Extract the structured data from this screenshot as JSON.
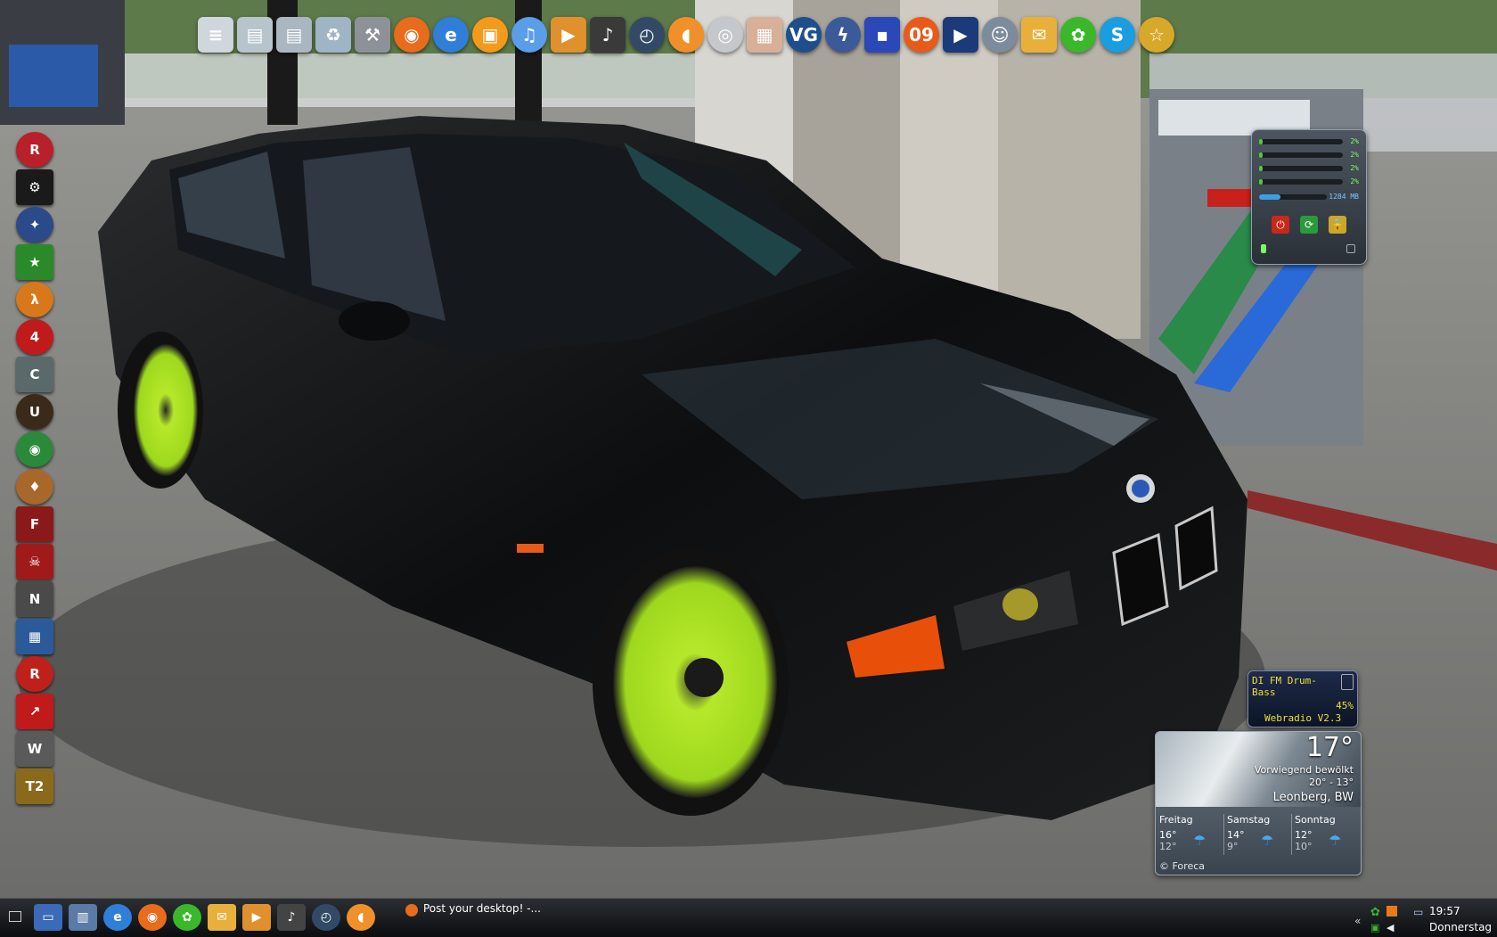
{
  "dock": {
    "icons": [
      {
        "name": "notes-icon",
        "glyph": "≡",
        "color": "#cfd6dc",
        "sq": true
      },
      {
        "name": "documents-folder-icon",
        "glyph": "▤",
        "color": "#b8c4cc",
        "sq": true
      },
      {
        "name": "folder-icon",
        "glyph": "▤",
        "color": "#aab6c0",
        "sq": true
      },
      {
        "name": "recycle-bin-icon",
        "glyph": "♻",
        "color": "#9fb4c4",
        "sq": true
      },
      {
        "name": "tools-icon",
        "glyph": "⚒",
        "color": "#8c9298",
        "sq": true
      },
      {
        "name": "firefox-icon",
        "glyph": "◉",
        "color": "#e96b1c"
      },
      {
        "name": "internet-explorer-icon",
        "glyph": "e",
        "color": "#2f7fd8"
      },
      {
        "name": "tv-icon",
        "glyph": "▣",
        "color": "#f49a1a"
      },
      {
        "name": "itunes-icon",
        "glyph": "♫",
        "color": "#5a9ee8"
      },
      {
        "name": "media-player-icon",
        "glyph": "▶",
        "color": "#e0902c",
        "sq": true
      },
      {
        "name": "music-note-icon",
        "glyph": "♪",
        "color": "#3a3a3a",
        "sq": true
      },
      {
        "name": "clock-icon",
        "glyph": "◴",
        "color": "#334a66"
      },
      {
        "name": "ear-icon",
        "glyph": "◖",
        "color": "#f0902a"
      },
      {
        "name": "cd-icon",
        "glyph": "◎",
        "color": "#c4c8cc"
      },
      {
        "name": "photos-icon",
        "glyph": "▦",
        "color": "#d8b098",
        "sq": true
      },
      {
        "name": "vg-icon",
        "glyph": "VG",
        "color": "#1e4f8c"
      },
      {
        "name": "lightning-icon",
        "glyph": "ϟ",
        "color": "#3a5a9a"
      },
      {
        "name": "floppy-save-icon",
        "glyph": "▪",
        "color": "#2a48b8",
        "sq": true
      },
      {
        "name": "burn-09-icon",
        "glyph": "09",
        "color": "#e85a1a"
      },
      {
        "name": "media-play-icon",
        "glyph": "▶",
        "color": "#1a3a7a",
        "sq": true
      },
      {
        "name": "headset-user-icon",
        "glyph": "☺",
        "color": "#7c8c9c"
      },
      {
        "name": "mail-icon",
        "glyph": "✉",
        "color": "#e8b03a",
        "sq": true
      },
      {
        "name": "icq-flower-icon",
        "glyph": "✿",
        "color": "#3ab82a"
      },
      {
        "name": "skype-icon",
        "glyph": "S",
        "color": "#1a9ee0"
      },
      {
        "name": "fox-icon",
        "glyph": "☆",
        "color": "#d8a82a"
      }
    ]
  },
  "left_icons": [
    {
      "name": "rockstar-icon",
      "glyph": "R",
      "color": "#b8202a"
    },
    {
      "name": "steam-icon",
      "glyph": "⚙",
      "color": "#1a1a1a",
      "sq": true
    },
    {
      "name": "counter-strike-icon",
      "glyph": "✦",
      "color": "#2a4a8a"
    },
    {
      "name": "star-game-icon",
      "glyph": "★",
      "color": "#2a8a2a",
      "sq": true
    },
    {
      "name": "half-life-2-icon",
      "glyph": "λ",
      "color": "#d8781a"
    },
    {
      "name": "left-4-dead-icon",
      "glyph": "4",
      "color": "#c01a1a"
    },
    {
      "name": "crysis-icon",
      "glyph": "C",
      "color": "#5a6a6a",
      "sq": true
    },
    {
      "name": "unreal-icon",
      "glyph": "U",
      "color": "#3a2a1a"
    },
    {
      "name": "target-game-icon",
      "glyph": "◉",
      "color": "#2a8a3a"
    },
    {
      "name": "medal-game-icon",
      "glyph": "♦",
      "color": "#a8682a"
    },
    {
      "name": "fear-2-icon",
      "glyph": "F",
      "color": "#8a1a1a",
      "sq": true
    },
    {
      "name": "red-mask-icon",
      "glyph": "☠",
      "color": "#a01a1a",
      "sq": true
    },
    {
      "name": "need-for-speed-icon",
      "glyph": "N",
      "color": "#4a4a4a",
      "sq": true
    },
    {
      "name": "blue-game-icon",
      "glyph": "▦",
      "color": "#2a5a9a",
      "sq": true
    },
    {
      "name": "racing-game-icon",
      "glyph": "R",
      "color": "#c0201a"
    },
    {
      "name": "arrow-game-icon",
      "glyph": "↗",
      "color": "#c01a1a",
      "sq": true
    },
    {
      "name": "wings-game-icon",
      "glyph": "W",
      "color": "#5a5a5a",
      "sq": true
    },
    {
      "name": "trials-2-icon",
      "glyph": "T2",
      "color": "#8a6a1a",
      "sq": true
    }
  ],
  "cpu_meter": {
    "cores": [
      {
        "pct_label": "2%",
        "fraction": 0.02
      },
      {
        "pct_label": "2%",
        "fraction": 0.02
      },
      {
        "pct_label": "2%",
        "fraction": 0.02
      },
      {
        "pct_label": "2%",
        "fraction": 0.02
      }
    ],
    "memory_label": "1284 MB",
    "memory_fraction": 0.32,
    "buttons": {
      "power": {
        "glyph": "⏻",
        "color": "#c8281a"
      },
      "restart": {
        "glyph": "⟳",
        "color": "#2a9a3a"
      },
      "lock": {
        "glyph": "🔒",
        "color": "#c8a82a"
      }
    }
  },
  "radio": {
    "station": "DI FM Drum-",
    "station_line2": "Bass",
    "volume": "45%",
    "version": "Webradio V2.3"
  },
  "weather": {
    "temperature": "17°",
    "condition": "Vorwiegend bewölkt",
    "range": "20° - 13°",
    "location": "Leonberg, BW",
    "forecast": [
      {
        "day": "Freitag",
        "high": "16°",
        "low": "12°"
      },
      {
        "day": "Samstag",
        "high": "14°",
        "low": "9°"
      },
      {
        "day": "Sonntag",
        "high": "12°",
        "low": "10°"
      }
    ],
    "credit": "© Foreca"
  },
  "taskbar": {
    "quick_launch": [
      {
        "name": "show-desktop-icon",
        "glyph": "▭",
        "color": "#3a6ab8",
        "sq": true
      },
      {
        "name": "switch-windows-icon",
        "glyph": "▥",
        "color": "#5a7aa8",
        "sq": true
      },
      {
        "name": "ie-quick-icon",
        "glyph": "e",
        "color": "#2f7fd8"
      },
      {
        "name": "firefox-quick-icon",
        "glyph": "◉",
        "color": "#e96b1c"
      },
      {
        "name": "icq-quick-icon",
        "glyph": "✿",
        "color": "#3ab82a"
      },
      {
        "name": "mail-quick-icon",
        "glyph": "✉",
        "color": "#e8b03a",
        "sq": true
      },
      {
        "name": "media-quick-icon",
        "glyph": "▶",
        "color": "#e0902c",
        "sq": true
      },
      {
        "name": "music-quick-icon",
        "glyph": "♪",
        "color": "#444444",
        "sq": true
      },
      {
        "name": "clock-quick-icon",
        "glyph": "◴",
        "color": "#334a66"
      },
      {
        "name": "ear-quick-icon",
        "glyph": "◖",
        "color": "#f0902a"
      }
    ],
    "active_task": "Post your desktop! -...",
    "clock": {
      "time": "19:57",
      "day": "Donnerstag"
    }
  }
}
